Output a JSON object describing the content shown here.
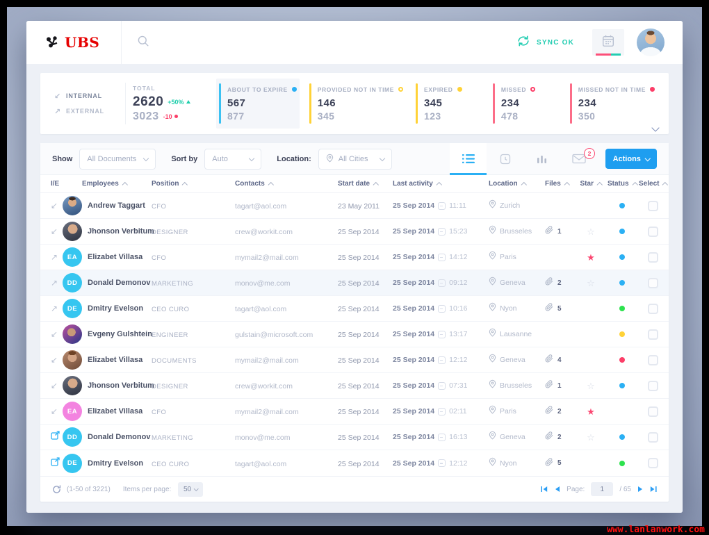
{
  "watermark": "www.lanlanwork.com",
  "topbar": {
    "logo": "UBS",
    "sync_status": "SYNC OK",
    "icons": {
      "search": "magnifier",
      "sync": "circular-arrows",
      "calendar": "calendar",
      "avatar": "user-photo"
    }
  },
  "stats": {
    "internal_label": "INTERNAL",
    "external_label": "EXTERNAL",
    "total": {
      "label": "TOTAL",
      "value_internal": "2620",
      "delta_internal": "+50%",
      "value_external": "3023",
      "delta_external": "-10"
    },
    "tiles": [
      {
        "label": "ABOUT TO EXPIRE",
        "value_top": "567",
        "value_bottom": "877",
        "accent": "#3bc1f2",
        "indicator": "filled",
        "indicator_color": "#2bb0f4",
        "selected": true
      },
      {
        "label": "PROVIDED NOT IN TIME",
        "value_top": "146",
        "value_bottom": "345",
        "accent": "#ffd237",
        "indicator": "outline",
        "indicator_color": "#ffd237",
        "selected": false
      },
      {
        "label": "EXPIRED",
        "value_top": "345",
        "value_bottom": "123",
        "accent": "#ffd237",
        "indicator": "filled",
        "indicator_color": "#ffd237",
        "selected": false
      },
      {
        "label": "MISSED",
        "value_top": "234",
        "value_bottom": "478",
        "accent": "#fc6d88",
        "indicator": "outline",
        "indicator_color": "#fc3e68",
        "selected": false
      },
      {
        "label": "MISSED NOT IN TIME",
        "value_top": "234",
        "value_bottom": "350",
        "accent": "#fc6d88",
        "indicator": "filled",
        "indicator_color": "#fc3e68",
        "selected": false
      }
    ]
  },
  "toolbar": {
    "show_label": "Show",
    "show_value": "All Documents",
    "sort_label": "Sort by",
    "sort_value": "Auto",
    "location_label": "Location:",
    "location_value": "All Cities",
    "mail_badge": "2",
    "actions_label": "Actions",
    "view_icons": [
      "list",
      "history",
      "bar-chart",
      "mail"
    ]
  },
  "table": {
    "columns": [
      "I/E",
      "Employees",
      "Position",
      "Contacts",
      "Start date",
      "Last activity",
      "Location",
      "Files",
      "Star",
      "Status",
      "Select"
    ],
    "rows": [
      {
        "ie": "internal",
        "avatar": "photo-1",
        "initials": "",
        "name": "Andrew Taggart",
        "position": "CFO",
        "contact": "tagart@aol.com",
        "start_date": "23 May 2011",
        "activity_date": "25 Sep 2014",
        "activity_time": "11:11",
        "location": "Zurich",
        "files": null,
        "star": null,
        "status": "#2bb0f4",
        "highlight": false
      },
      {
        "ie": "internal",
        "avatar": "photo-2",
        "initials": "",
        "name": "Jhonson Verbitum",
        "position": "DESIGNER",
        "contact": "crew@workit.com",
        "start_date": "25 Sep 2014",
        "activity_date": "25 Sep 2014",
        "activity_time": "15:23",
        "location": "Brusseles",
        "files": "1",
        "star": "empty",
        "status": "#2bb0f4",
        "highlight": false
      },
      {
        "ie": "external",
        "avatar": "initials-cyan",
        "initials": "EA",
        "name": "Elizabet Villasa",
        "position": "CFO",
        "contact": "mymail2@mail.com",
        "start_date": "25 Sep 2014",
        "activity_date": "25 Sep 2014",
        "activity_time": "14:12",
        "location": "Paris",
        "files": null,
        "star": "filled",
        "status": "#2bb0f4",
        "highlight": false
      },
      {
        "ie": "external",
        "avatar": "initials-cyan",
        "initials": "DD",
        "name": "Donald Demonov",
        "position": "MARKETING",
        "contact": "monov@me.com",
        "start_date": "25 Sep 2014",
        "activity_date": "25 Sep 2014",
        "activity_time": "09:12",
        "location": "Geneva",
        "files": "2",
        "star": "empty",
        "status": "#2bb0f4",
        "highlight": true
      },
      {
        "ie": "external",
        "avatar": "initials-cyan",
        "initials": "DE",
        "name": "Dmitry Evelson",
        "position": "CEO CURO",
        "contact": "tagart@aol.com",
        "start_date": "25 Sep 2014",
        "activity_date": "25 Sep 2014",
        "activity_time": "10:16",
        "location": "Nyon",
        "files": "5",
        "star": null,
        "status": "#2de24e",
        "highlight": false
      },
      {
        "ie": "internal",
        "avatar": "photo-3",
        "initials": "",
        "name": "Evgeny Gulshtein",
        "position": "ENGINEER",
        "contact": "gulstain@microsoft.com",
        "start_date": "25 Sep 2014",
        "activity_date": "25 Sep 2014",
        "activity_time": "13:17",
        "location": "Lausanne",
        "files": null,
        "star": null,
        "status": "#ffd237",
        "highlight": false
      },
      {
        "ie": "internal",
        "avatar": "photo-4",
        "initials": "",
        "name": "Elizabet Villasa",
        "position": "DOCUMENTS",
        "contact": "mymail2@mail.com",
        "start_date": "25 Sep 2014",
        "activity_date": "25 Sep 2014",
        "activity_time": "12:12",
        "location": "Geneva",
        "files": "4",
        "star": null,
        "status": "#fc3e68",
        "highlight": false
      },
      {
        "ie": "internal",
        "avatar": "photo-2",
        "initials": "",
        "name": "Jhonson Verbitum",
        "position": "DESIGNER",
        "contact": "crew@workit.com",
        "start_date": "25 Sep 2014",
        "activity_date": "25 Sep 2014",
        "activity_time": "07:31",
        "location": "Brusseles",
        "files": "1",
        "star": "empty",
        "status": "#2bb0f4",
        "highlight": false
      },
      {
        "ie": "internal",
        "avatar": "initials-pink",
        "initials": "EA",
        "name": "Elizabet Villasa",
        "position": "CFO",
        "contact": "mymail2@mail.com",
        "start_date": "25 Sep 2014",
        "activity_date": "25 Sep 2014",
        "activity_time": "02:11",
        "location": "Paris",
        "files": "2",
        "star": "filled",
        "status": null,
        "highlight": false
      },
      {
        "ie": "external-link",
        "avatar": "initials-cyan",
        "initials": "DD",
        "name": "Donald Demonov",
        "position": "MARKETING",
        "contact": "monov@me.com",
        "start_date": "25 Sep 2014",
        "activity_date": "25 Sep 2014",
        "activity_time": "16:13",
        "location": "Geneva",
        "files": "2",
        "star": "empty",
        "status": "#2bb0f4",
        "highlight": false
      },
      {
        "ie": "external-link",
        "avatar": "initials-cyan",
        "initials": "DE",
        "name": "Dmitry Evelson",
        "position": "CEO CURO",
        "contact": "tagart@aol.com",
        "start_date": "25 Sep 2014",
        "activity_date": "25 Sep 2014",
        "activity_time": "12:12",
        "location": "Nyon",
        "files": "5",
        "star": null,
        "status": "#2de24e",
        "highlight": false
      }
    ]
  },
  "pagination": {
    "range": "(1-50 of 3221)",
    "items_per_page_label": "Items per page:",
    "items_per_page": "50",
    "page_label": "Page:",
    "current_page": "1",
    "total_pages": "/ 65"
  }
}
